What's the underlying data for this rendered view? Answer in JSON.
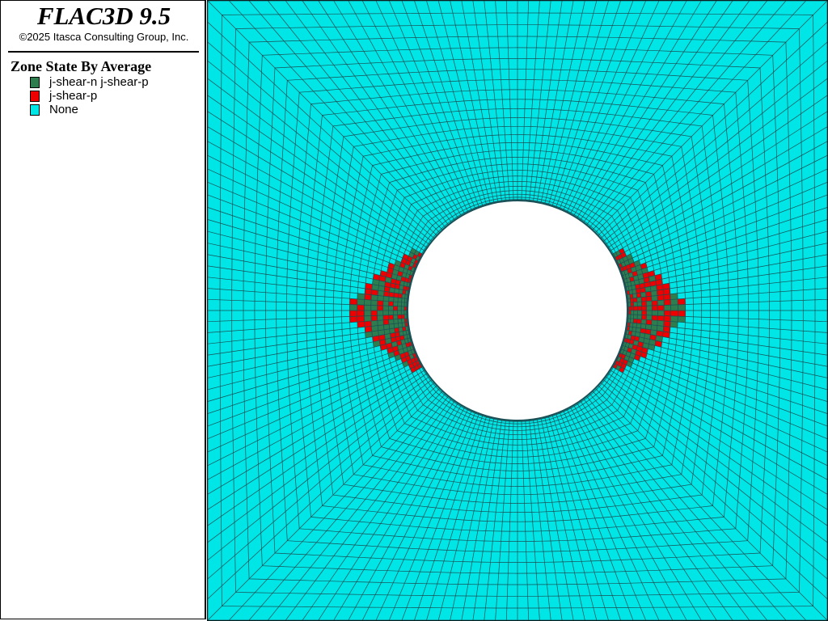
{
  "header": {
    "app_title": "FLAC3D 9.5",
    "copyright": "©2025 Itasca Consulting Group, Inc."
  },
  "legend": {
    "title": "Zone State By Average",
    "items": [
      {
        "label": "j-shear-n j-shear-p",
        "color": "#2e7d4f"
      },
      {
        "label": "j-shear-p",
        "color": "#ee0000"
      },
      {
        "label": "None",
        "color": "#00e5e5"
      }
    ]
  },
  "model_view": {
    "background_color": "#00e5e5",
    "mesh_line_color": "#1a4f55",
    "tunnel_color": "#ffffff"
  }
}
